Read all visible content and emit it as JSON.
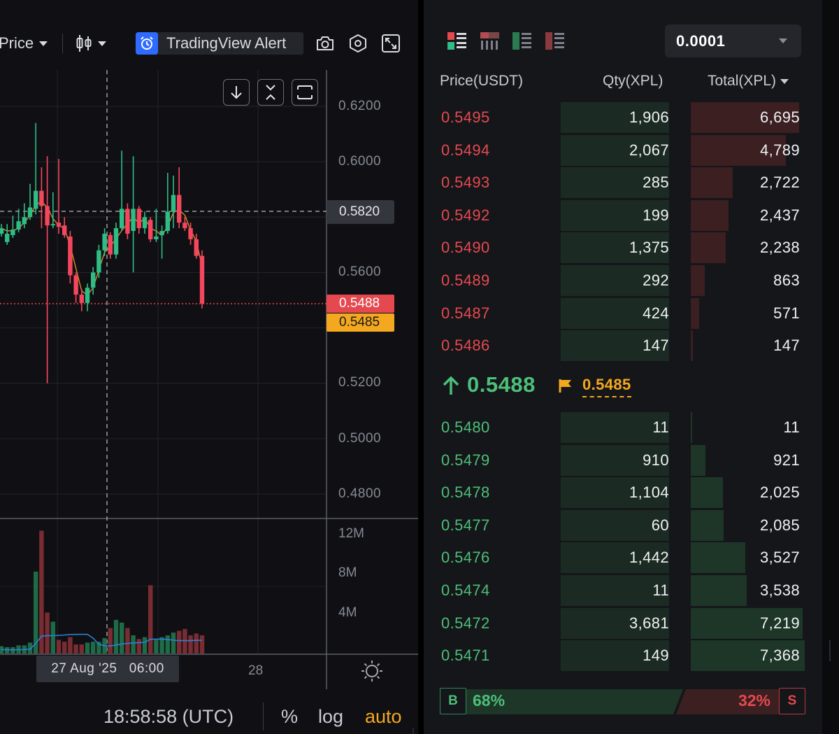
{
  "toolbar": {
    "price_type_label": "Price",
    "alert_label": "TradingView Alert"
  },
  "chart": {
    "price_ticks": [
      "0.6200",
      "0.6000",
      "0.5600",
      "0.5200",
      "0.5000",
      "0.4800"
    ],
    "crosshair_price": "0.5820",
    "last_price_tag": "0.5488",
    "mark_price_tag": "0.5485",
    "volume_ticks": [
      "12M",
      "8M",
      "4M"
    ],
    "crosshair_date": "27 Aug '25   06:00",
    "x_tick": "28",
    "colors": {
      "up": "#2ebd85",
      "down": "#f6465d",
      "last": "#e5494f",
      "mark": "#f3a81f"
    }
  },
  "chart_data": {
    "type": "candlestick",
    "y_axis": {
      "range": [
        0.47,
        0.63
      ]
    },
    "candles": [
      {
        "o": 0.574,
        "c": 0.576,
        "h": 0.5775,
        "l": 0.573
      },
      {
        "o": 0.571,
        "c": 0.574,
        "h": 0.5775,
        "l": 0.57
      },
      {
        "o": 0.5735,
        "c": 0.5755,
        "h": 0.5805,
        "l": 0.5725
      },
      {
        "o": 0.5755,
        "c": 0.5785,
        "h": 0.583,
        "l": 0.5745
      },
      {
        "o": 0.5775,
        "c": 0.58,
        "h": 0.585,
        "l": 0.576
      },
      {
        "o": 0.58,
        "c": 0.5835,
        "h": 0.592,
        "l": 0.579
      },
      {
        "o": 0.583,
        "c": 0.5895,
        "h": 0.614,
        "l": 0.581
      },
      {
        "o": 0.5895,
        "c": 0.584,
        "h": 0.598,
        "l": 0.576
      },
      {
        "o": 0.584,
        "c": 0.577,
        "h": 0.602,
        "l": 0.52
      },
      {
        "o": 0.577,
        "c": 0.5775,
        "h": 0.589,
        "l": 0.576
      },
      {
        "o": 0.578,
        "c": 0.5765,
        "h": 0.601,
        "l": 0.574
      },
      {
        "o": 0.577,
        "c": 0.5735,
        "h": 0.58,
        "l": 0.5725
      },
      {
        "o": 0.573,
        "c": 0.559,
        "h": 0.575,
        "l": 0.556
      },
      {
        "o": 0.559,
        "c": 0.552,
        "h": 0.56,
        "l": 0.549
      },
      {
        "o": 0.552,
        "c": 0.549,
        "h": 0.554,
        "l": 0.546
      },
      {
        "o": 0.549,
        "c": 0.5545,
        "h": 0.556,
        "l": 0.546
      },
      {
        "o": 0.5545,
        "c": 0.56,
        "h": 0.562,
        "l": 0.552
      },
      {
        "o": 0.56,
        "c": 0.568,
        "h": 0.57,
        "l": 0.558
      },
      {
        "o": 0.568,
        "c": 0.574,
        "h": 0.576,
        "l": 0.566
      },
      {
        "o": 0.5735,
        "c": 0.5665,
        "h": 0.5745,
        "l": 0.565
      },
      {
        "o": 0.5665,
        "c": 0.576,
        "h": 0.578,
        "l": 0.565
      },
      {
        "o": 0.576,
        "c": 0.583,
        "h": 0.604,
        "l": 0.575
      },
      {
        "o": 0.583,
        "c": 0.574,
        "h": 0.585,
        "l": 0.572
      },
      {
        "o": 0.575,
        "c": 0.583,
        "h": 0.602,
        "l": 0.56
      },
      {
        "o": 0.583,
        "c": 0.576,
        "h": 0.584,
        "l": 0.574
      },
      {
        "o": 0.576,
        "c": 0.58,
        "h": 0.582,
        "l": 0.574
      },
      {
        "o": 0.579,
        "c": 0.572,
        "h": 0.58,
        "l": 0.571
      },
      {
        "o": 0.572,
        "c": 0.573,
        "h": 0.583,
        "l": 0.571
      },
      {
        "o": 0.5735,
        "c": 0.575,
        "h": 0.577,
        "l": 0.565
      },
      {
        "o": 0.575,
        "c": 0.582,
        "h": 0.596,
        "l": 0.574
      },
      {
        "o": 0.582,
        "c": 0.588,
        "h": 0.595,
        "l": 0.576
      },
      {
        "o": 0.588,
        "c": 0.578,
        "h": 0.598,
        "l": 0.576
      },
      {
        "o": 0.578,
        "c": 0.576,
        "h": 0.58,
        "l": 0.575
      },
      {
        "o": 0.576,
        "c": 0.572,
        "h": 0.578,
        "l": 0.57
      },
      {
        "o": 0.572,
        "c": 0.566,
        "h": 0.574,
        "l": 0.565
      },
      {
        "o": 0.566,
        "c": 0.5488,
        "h": 0.568,
        "l": 0.547
      }
    ],
    "volume_range": [
      0,
      14000000
    ],
    "volumes": [
      800000,
      700000,
      700000,
      900000,
      900000,
      1200000,
      9000000,
      13500000,
      4500000,
      3500000,
      1500000,
      1300000,
      1800000,
      1000000,
      1000000,
      1200000,
      1300000,
      1300000,
      1700000,
      2800000,
      3700000,
      3400000,
      2800000,
      2000000,
      1600000,
      1800000,
      7500000,
      1500000,
      1800000,
      2000000,
      2300000,
      2500000,
      2700000,
      2000000,
      2200000,
      2000000
    ]
  },
  "footer": {
    "time": "18:58:58 (UTC)",
    "percent": "%",
    "log": "log",
    "auto": "auto"
  },
  "book": {
    "tick_size": "0.0001",
    "headers": {
      "price": "Price(USDT)",
      "qty": "Qty(XPL)",
      "total": "Total(XPL)"
    },
    "asks": [
      {
        "price": "0.5495",
        "qty": "1,906",
        "total": "6,695",
        "depth": 1.0
      },
      {
        "price": "0.5494",
        "qty": "2,067",
        "total": "4,789",
        "depth": 0.88
      },
      {
        "price": "0.5493",
        "qty": "285",
        "total": "2,722",
        "depth": 0.39
      },
      {
        "price": "0.5492",
        "qty": "199",
        "total": "2,437",
        "depth": 0.35
      },
      {
        "price": "0.5490",
        "qty": "1,375",
        "total": "2,238",
        "depth": 0.32
      },
      {
        "price": "0.5489",
        "qty": "292",
        "total": "863",
        "depth": 0.13
      },
      {
        "price": "0.5487",
        "qty": "424",
        "total": "571",
        "depth": 0.08
      },
      {
        "price": "0.5486",
        "qty": "147",
        "total": "147",
        "depth": 0.02
      }
    ],
    "last_price": "0.5488",
    "mark_price": "0.5485",
    "bids": [
      {
        "price": "0.5480",
        "qty": "11",
        "total": "11",
        "depth": 0.01
      },
      {
        "price": "0.5479",
        "qty": "910",
        "total": "921",
        "depth": 0.13
      },
      {
        "price": "0.5478",
        "qty": "1,104",
        "total": "2,025",
        "depth": 0.28
      },
      {
        "price": "0.5477",
        "qty": "60",
        "total": "2,085",
        "depth": 0.29
      },
      {
        "price": "0.5476",
        "qty": "1,442",
        "total": "3,527",
        "depth": 0.48
      },
      {
        "price": "0.5474",
        "qty": "11",
        "total": "3,538",
        "depth": 0.49
      },
      {
        "price": "0.5472",
        "qty": "3,681",
        "total": "7,219",
        "depth": 0.98
      },
      {
        "price": "0.5471",
        "qty": "149",
        "total": "7,368",
        "depth": 1.0
      }
    ],
    "buy_label": "B",
    "sell_label": "S",
    "buy_pct": "68%",
    "sell_pct": "32%",
    "buy_ratio": 0.68
  }
}
